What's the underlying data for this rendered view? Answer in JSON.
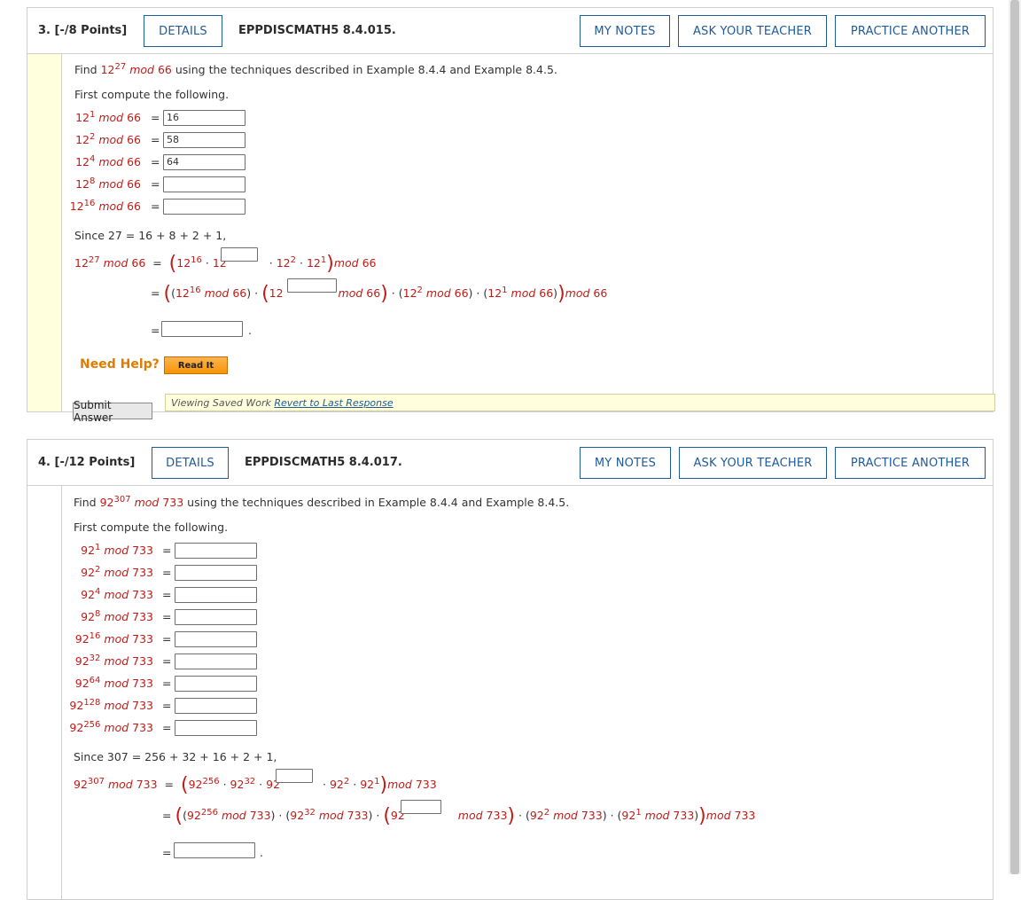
{
  "q3": {
    "number": "3. [-/8 Points]",
    "details": "DETAILS",
    "code": "EPPDISCMATH5 8.4.015.",
    "my_notes": "MY NOTES",
    "ask_teacher": "ASK YOUR TEACHER",
    "practice": "PRACTICE ANOTHER",
    "find_prefix": "Find ",
    "base": "12",
    "exp": "27",
    "mod": "mod",
    "modulus": "66",
    "find_suffix": " using the techniques described in Example 8.4.4 and Example 8.4.5.",
    "first_compute": "First compute the following.",
    "rows": [
      {
        "exp": "1",
        "value": "16"
      },
      {
        "exp": "2",
        "value": "58"
      },
      {
        "exp": "4",
        "value": "64"
      },
      {
        "exp": "8",
        "value": ""
      },
      {
        "exp": "16",
        "value": ""
      }
    ],
    "since": "Since 27 = 16 + 8 + 2 + 1,",
    "need_help": "Need Help?",
    "read_it": "Read It",
    "submit": "Submit Answer",
    "saved_text": "Viewing Saved Work ",
    "revert": "Revert to Last Response"
  },
  "q4": {
    "number": "4. [-/12 Points]",
    "details": "DETAILS",
    "code": "EPPDISCMATH5 8.4.017.",
    "my_notes": "MY NOTES",
    "ask_teacher": "ASK YOUR TEACHER",
    "practice": "PRACTICE ANOTHER",
    "find_prefix": "Find ",
    "base": "92",
    "exp": "307",
    "mod": "mod",
    "modulus": "733",
    "find_suffix": " using the techniques described in Example 8.4.4 and Example 8.4.5.",
    "first_compute": "First compute the following.",
    "rows": [
      {
        "exp": "1",
        "value": ""
      },
      {
        "exp": "2",
        "value": ""
      },
      {
        "exp": "4",
        "value": ""
      },
      {
        "exp": "8",
        "value": ""
      },
      {
        "exp": "16",
        "value": ""
      },
      {
        "exp": "32",
        "value": ""
      },
      {
        "exp": "64",
        "value": ""
      },
      {
        "exp": "128",
        "value": ""
      },
      {
        "exp": "256",
        "value": ""
      }
    ],
    "since": "Since 307 = 256 + 32 + 16 + 2 + 1,"
  },
  "symbols": {
    "eq": "=",
    "dot": "·",
    "period": "."
  }
}
